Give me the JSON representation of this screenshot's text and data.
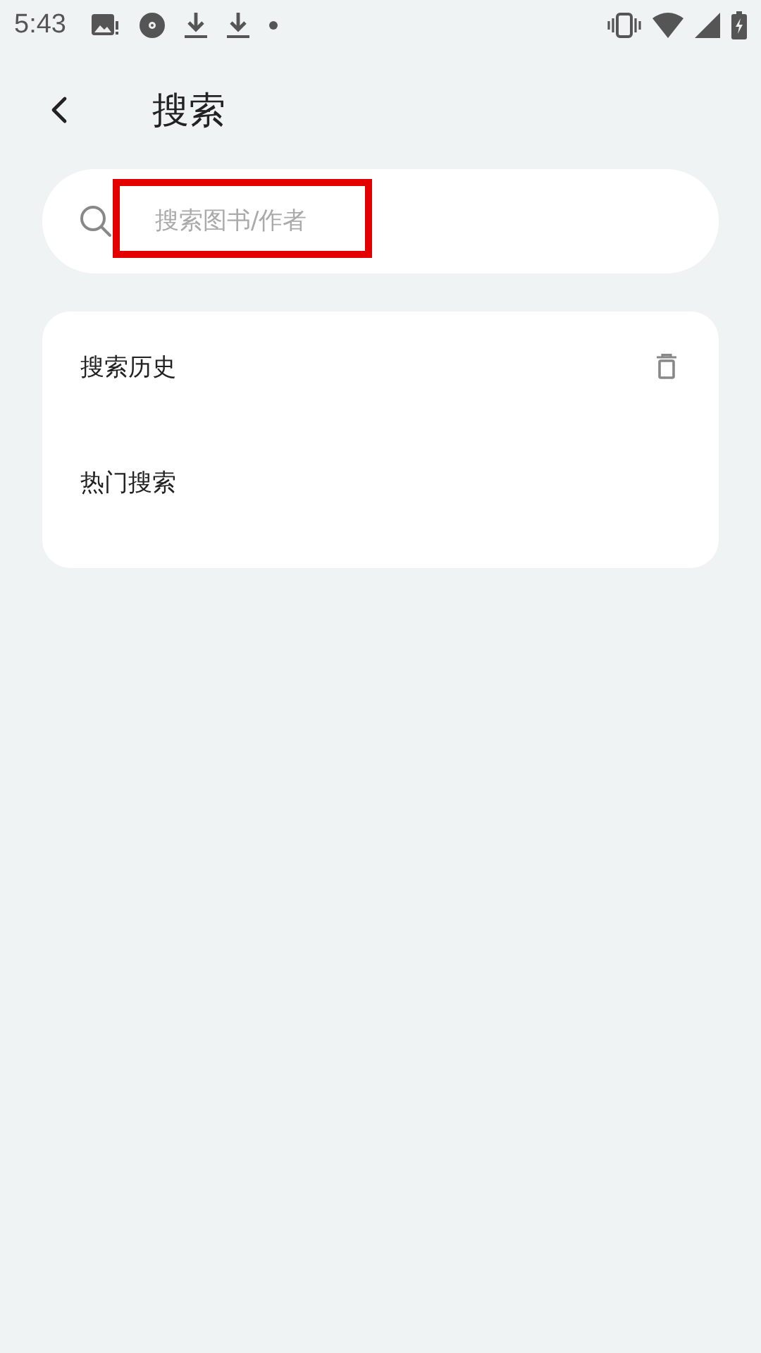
{
  "status_bar": {
    "time": "5:43"
  },
  "header": {
    "title": "搜索"
  },
  "search": {
    "placeholder": "搜索图书/作者",
    "highlighted": true
  },
  "sections": [
    {
      "kind": "history",
      "title": "搜索历史"
    },
    {
      "kind": "trending",
      "title": "热门搜索"
    }
  ]
}
